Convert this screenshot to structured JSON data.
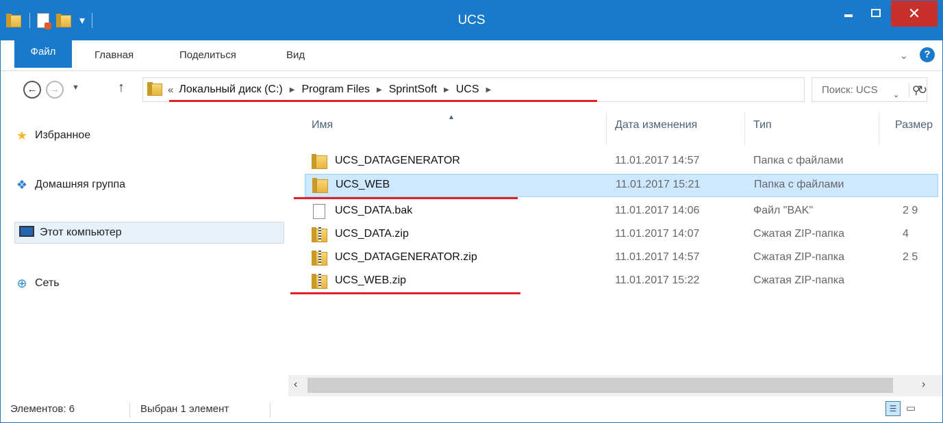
{
  "window": {
    "title": "UCS"
  },
  "ribbon": {
    "tabs": [
      {
        "label": "Файл"
      },
      {
        "label": "Главная"
      },
      {
        "label": "Поделиться"
      },
      {
        "label": "Вид"
      }
    ],
    "help_label": "?"
  },
  "address": {
    "prefix": "«",
    "crumbs": [
      "Локальный диск (C:)",
      "Program Files",
      "SprintSoft",
      "UCS"
    ],
    "search_placeholder": "Поиск: UCS"
  },
  "nav_pane": {
    "items": [
      {
        "label": "Избранное",
        "icon": "star-icon"
      },
      {
        "label": "Домашняя группа",
        "icon": "homegroup-icon"
      },
      {
        "label": "Этот компьютер",
        "icon": "computer-icon",
        "selected": true
      },
      {
        "label": "Сеть",
        "icon": "network-icon"
      }
    ]
  },
  "file_list": {
    "columns": [
      "Имя",
      "Дата изменения",
      "Тип",
      "Размер"
    ],
    "rows": [
      {
        "name": "UCS_DATAGENERATOR",
        "date": "11.01.2017 14:57",
        "type": "Папка с файлами",
        "size": "",
        "icon": "folder-icon"
      },
      {
        "name": "UCS_WEB",
        "date": "11.01.2017 15:21",
        "type": "Папка с файлами",
        "size": "",
        "icon": "folder-icon",
        "selected": true
      },
      {
        "name": "UCS_DATA.bak",
        "date": "11.01.2017 14:06",
        "type": "Файл \"BAK\"",
        "size": "2 9",
        "icon": "file-icon"
      },
      {
        "name": "UCS_DATA.zip",
        "date": "11.01.2017 14:07",
        "type": "Сжатая ZIP-папка",
        "size": "4",
        "icon": "zip-folder-icon"
      },
      {
        "name": "UCS_DATAGENERATOR.zip",
        "date": "11.01.2017 14:57",
        "type": "Сжатая ZIP-папка",
        "size": "2 5",
        "icon": "zip-folder-icon"
      },
      {
        "name": "UCS_WEB.zip",
        "date": "11.01.2017 15:22",
        "type": "Сжатая ZIP-папка",
        "size": "",
        "icon": "zip-folder-icon"
      }
    ]
  },
  "status": {
    "count": "Элементов: 6",
    "selection": "Выбран 1 элемент"
  },
  "colors": {
    "accent": "#1979ca",
    "close": "#c7302b",
    "selection": "#cde8ff",
    "annotation_red": "#e31e24"
  }
}
